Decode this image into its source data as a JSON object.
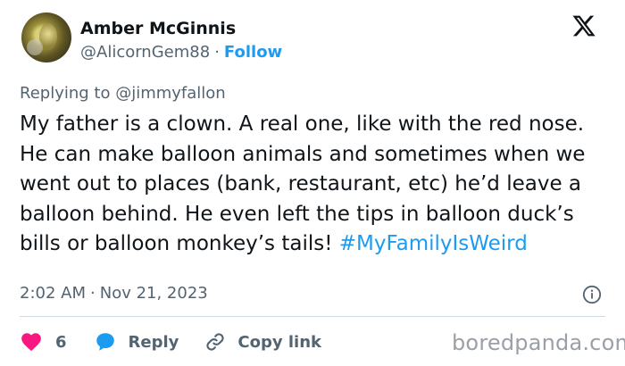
{
  "author": {
    "name": "Amber McGinnis",
    "handle": "@AlicornGem88",
    "separator": "·",
    "follow_label": "Follow"
  },
  "reply_context": "Replying to @jimmyfallon",
  "tweet": {
    "text": "My father is a clown. A real one, like with the red nose. He can make balloon animals and sometimes when we went out to places (bank, restaurant, etc) he’d leave a balloon behind. He even left the tips in balloon duck’s bills or balloon monkey’s tails!",
    "hashtag": "#MyFamilyIsWeird"
  },
  "meta": {
    "time": "2:02 AM",
    "separator": "·",
    "date": "Nov 21, 2023"
  },
  "actions": {
    "like_count": "6",
    "reply_label": "Reply",
    "copy_link_label": "Copy link"
  },
  "watermark": "boredpanda.com",
  "icons": {
    "logo": "x-logo-icon",
    "info": "info-icon",
    "like": "heart-icon",
    "reply": "speech-bubble-icon",
    "copy": "link-icon"
  },
  "colors": {
    "link": "#1d9bf0",
    "heart": "#f91880",
    "muted": "#536471",
    "text": "#0f1419"
  }
}
